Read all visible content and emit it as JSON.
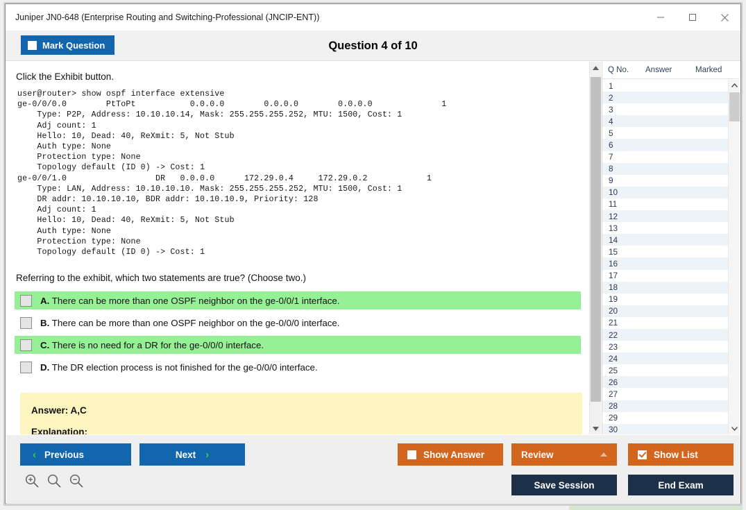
{
  "window": {
    "title": "Juniper JN0-648 (Enterprise Routing and Switching-Professional (JNCIP-ENT))",
    "minimize_label": "minimize",
    "maximize_label": "maximize",
    "close_label": "close"
  },
  "header": {
    "mark_question_label": "Mark Question",
    "question_counter": "Question 4 of 10"
  },
  "main": {
    "lead_text": "Click the Exhibit button.",
    "exhibit": "user@router> show ospf interface extensive\nge-0/0/0.0        PtToPt           0.0.0.0        0.0.0.0        0.0.0.0              1\n    Type: P2P, Address: 10.10.10.14, Mask: 255.255.255.252, MTU: 1500, Cost: 1\n    Adj count: 1\n    Hello: 10, Dead: 40, ReXmit: 5, Not Stub\n    Auth type: None\n    Protection type: None\n    Topology default (ID 0) -> Cost: 1\nge-0/0/1.0                  DR   0.0.0.0      172.29.0.4     172.29.0.2            1\n    Type: LAN, Address: 10.10.10.10. Mask: 255.255.255.252, MTU: 1500, Cost: 1\n    DR addr: 10.10.10.10, BDR addr: 10.10.10.9, Priority: 128\n    Adj count: 1\n    Hello: 10, Dead: 40, ReXmit: 5, Not Stub\n    Auth type: None\n    Protection type: None\n    Topology default (ID 0) -> Cost: 1",
    "question_text": "Referring to the exhibit, which two statements are true? (Choose two.)",
    "options": [
      {
        "letter": "A.",
        "text": "There can be more than one OSPF neighbor on the ge-0/0/1 interface.",
        "highlighted": true,
        "checked": false
      },
      {
        "letter": "B.",
        "text": "There can be more than one OSPF neighbor on the ge-0/0/0 interface.",
        "highlighted": false,
        "checked": false
      },
      {
        "letter": "C.",
        "text": "There is no need for a DR for the ge-0/0/0 interface.",
        "highlighted": true,
        "checked": false
      },
      {
        "letter": "D.",
        "text": "The DR election process is not finished for the ge-0/0/0 interface.",
        "highlighted": false,
        "checked": false
      }
    ],
    "answer_label": "Answer: A,C",
    "explanation_label": "Explanation:"
  },
  "question_list": {
    "columns": [
      "Q No.",
      "Answer",
      "Marked"
    ],
    "rows": [
      {
        "no": "1",
        "answer": "",
        "marked": ""
      },
      {
        "no": "2",
        "answer": "",
        "marked": ""
      },
      {
        "no": "3",
        "answer": "",
        "marked": ""
      },
      {
        "no": "4",
        "answer": "",
        "marked": ""
      },
      {
        "no": "5",
        "answer": "",
        "marked": ""
      },
      {
        "no": "6",
        "answer": "",
        "marked": ""
      },
      {
        "no": "7",
        "answer": "",
        "marked": ""
      },
      {
        "no": "8",
        "answer": "",
        "marked": ""
      },
      {
        "no": "9",
        "answer": "",
        "marked": ""
      },
      {
        "no": "10",
        "answer": "",
        "marked": ""
      },
      {
        "no": "11",
        "answer": "",
        "marked": ""
      },
      {
        "no": "12",
        "answer": "",
        "marked": ""
      },
      {
        "no": "13",
        "answer": "",
        "marked": ""
      },
      {
        "no": "14",
        "answer": "",
        "marked": ""
      },
      {
        "no": "15",
        "answer": "",
        "marked": ""
      },
      {
        "no": "16",
        "answer": "",
        "marked": ""
      },
      {
        "no": "17",
        "answer": "",
        "marked": ""
      },
      {
        "no": "18",
        "answer": "",
        "marked": ""
      },
      {
        "no": "19",
        "answer": "",
        "marked": ""
      },
      {
        "no": "20",
        "answer": "",
        "marked": ""
      },
      {
        "no": "21",
        "answer": "",
        "marked": ""
      },
      {
        "no": "22",
        "answer": "",
        "marked": ""
      },
      {
        "no": "23",
        "answer": "",
        "marked": ""
      },
      {
        "no": "24",
        "answer": "",
        "marked": ""
      },
      {
        "no": "25",
        "answer": "",
        "marked": ""
      },
      {
        "no": "26",
        "answer": "",
        "marked": ""
      },
      {
        "no": "27",
        "answer": "",
        "marked": ""
      },
      {
        "no": "28",
        "answer": "",
        "marked": ""
      },
      {
        "no": "29",
        "answer": "",
        "marked": ""
      },
      {
        "no": "30",
        "answer": "",
        "marked": ""
      }
    ]
  },
  "toolbar": {
    "previous_label": "Previous",
    "next_label": "Next",
    "prev_chevron": "‹",
    "next_chevron": "›",
    "show_answer_label": "Show Answer",
    "show_answer_checked": false,
    "review_label": "Review",
    "show_list_label": "Show List",
    "show_list_checked": true,
    "save_session_label": "Save Session",
    "end_exam_label": "End Exam",
    "zoom_in_name": "zoom-in",
    "zoom_reset_name": "zoom-reset",
    "zoom_out_name": "zoom-out"
  },
  "colors": {
    "blue": "#1166ad",
    "orange": "#d3661f",
    "navy": "#1c3148",
    "highlight_green": "#96f096",
    "answer_yellow": "#fcf5bf",
    "chevron_green": "#3bd43b"
  }
}
